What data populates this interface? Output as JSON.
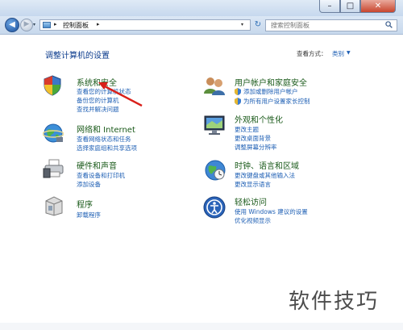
{
  "window": {
    "minimize_glyph": "–",
    "maximize_glyph": "□",
    "close_glyph": "✕"
  },
  "address_bar": {
    "back_glyph": "◀",
    "forward_glyph": "▶",
    "dropdown_glyph": "▾",
    "separator_glyph": "▸",
    "crumb": "控制面板",
    "refresh_glyph": "↻",
    "search_placeholder": "搜索控制面板"
  },
  "header": {
    "title": "调整计算机的设置",
    "view_by_label": "查看方式：",
    "view_by_value": "类别",
    "view_by_arrow": "▼"
  },
  "categories": {
    "system": {
      "icon": "system-security-shield-icon",
      "title": "系统和安全",
      "links": [
        "查看您的计算机状态",
        "备份您的计算机",
        "查找并解决问题"
      ]
    },
    "network": {
      "icon": "network-globe-icon",
      "title": "网络和 Internet",
      "links": [
        "查看网络状态和任务",
        "选择家庭组和共享选项"
      ]
    },
    "hardware": {
      "icon": "printer-icon",
      "title": "硬件和声音",
      "links": [
        "查看设备和打印机",
        "添加设备"
      ]
    },
    "programs": {
      "icon": "programs-box-icon",
      "title": "程序",
      "links": [
        "卸载程序"
      ]
    },
    "users": {
      "icon": "users-icon",
      "title": "用户帐户和家庭安全",
      "links": [
        "添加或删除用户帐户",
        "为所有用户设置家长控制"
      ]
    },
    "appearance": {
      "icon": "monitor-icon",
      "title": "外观和个性化",
      "links": [
        "更改主题",
        "更改桌面背景",
        "调整屏幕分辨率"
      ]
    },
    "clock": {
      "icon": "clock-globe-icon",
      "title": "时钟、语言和区域",
      "links": [
        "更改键盘或其他输入法",
        "更改显示语言"
      ]
    },
    "ease": {
      "icon": "ease-of-access-icon",
      "title": "轻松访问",
      "links": [
        "使用 Windows 建议的设置",
        "优化视频显示"
      ]
    }
  },
  "colors": {
    "link": "#1e5fb4",
    "category_title": "#1a5a1a",
    "annotation": "#d9201a"
  },
  "watermark": "软件技巧"
}
